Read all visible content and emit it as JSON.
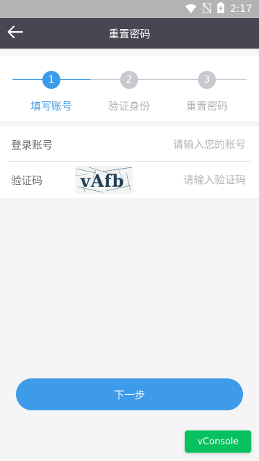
{
  "status_bar": {
    "time": "2:17",
    "icons": [
      "wifi-icon",
      "no-sim-icon",
      "battery-charging-icon"
    ]
  },
  "nav": {
    "title": "重置密码",
    "back_icon": "arrow-left-icon"
  },
  "steps": [
    {
      "number": "1",
      "label": "填写账号",
      "active": true
    },
    {
      "number": "2",
      "label": "验证身份",
      "active": false
    },
    {
      "number": "3",
      "label": "重置密码",
      "active": false
    }
  ],
  "form": {
    "account_label": "登录账号",
    "account_placeholder": "请输入您的账号",
    "account_value": "",
    "captcha_label": "验证码",
    "captcha_image_text": "vAfb",
    "captcha_placeholder": "请输入验证码",
    "captcha_value": ""
  },
  "next_button": "下一步",
  "vconsole_button": "vConsole",
  "colors": {
    "accent": "#3d9be9",
    "navbar": "#484652",
    "inactive": "#c7c9cf",
    "vconsole": "#07c160"
  }
}
